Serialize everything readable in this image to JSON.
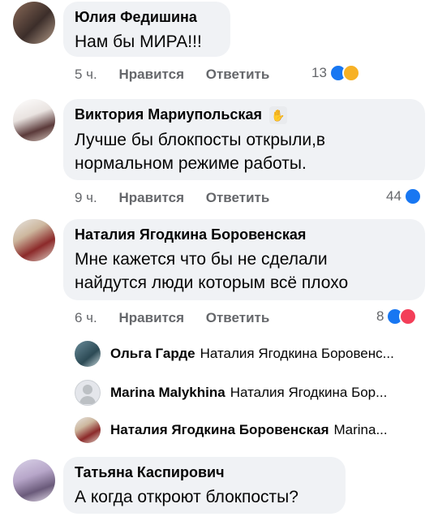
{
  "comments": [
    {
      "author": "Юлия Федишина",
      "text": "Нам бы МИРА!!!",
      "time": "5 ч.",
      "like": "Нравится",
      "reply": "Ответить",
      "count": "13"
    },
    {
      "author": "Виктория Мариупольская",
      "text": "Лучше бы блокпосты открыли,в нормальном режиме работы.",
      "time": "9 ч.",
      "like": "Нравится",
      "reply": "Ответить",
      "count": "44"
    },
    {
      "author": "Наталия Ягодкина Боровенская",
      "text": "Мне кажется что бы не сделали найдутся люди которым всё плохо",
      "time": "6 ч.",
      "like": "Нравится",
      "reply": "Ответить",
      "count": "8"
    },
    {
      "author": "Татьяна Каспирович",
      "text": "А когда откроют блокпосты?"
    }
  ],
  "replies": [
    {
      "name": "Ольга Гарде",
      "text": "Наталия Ягодкина Боровенс..."
    },
    {
      "name": "Marina Malykhina",
      "text": "Наталия Ягодкина Бор..."
    },
    {
      "name": "Наталия Ягодкина Боровенская",
      "text": "Marina..."
    }
  ],
  "colors": {
    "like_blue": "#1877f2",
    "love_red": "#f33e58",
    "care_yellow": "#f7b125",
    "bubble": "#f0f2f5",
    "meta": "#65676b"
  }
}
